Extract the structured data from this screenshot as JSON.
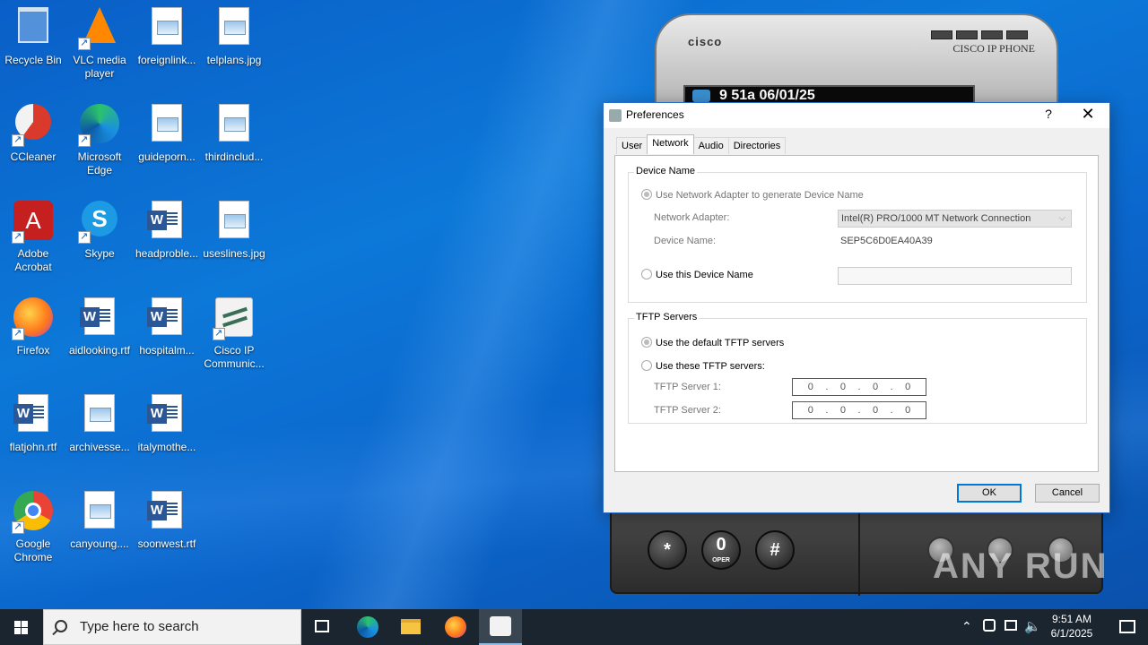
{
  "desktop": {
    "icons": [
      {
        "label": "Recycle Bin",
        "type": "recycle"
      },
      {
        "label": "VLC media player",
        "type": "vlc"
      },
      {
        "label": "foreignlink...",
        "type": "image"
      },
      {
        "label": "telplans.jpg",
        "type": "image"
      },
      {
        "label": "CCleaner",
        "type": "ccleaner"
      },
      {
        "label": "Microsoft Edge",
        "type": "edge"
      },
      {
        "label": "guideporn...",
        "type": "image"
      },
      {
        "label": "thirdinclud...",
        "type": "image"
      },
      {
        "label": "Adobe Acrobat",
        "type": "acrobat"
      },
      {
        "label": "Skype",
        "type": "skype"
      },
      {
        "label": "headproble...",
        "type": "word"
      },
      {
        "label": "useslines.jpg",
        "type": "image"
      },
      {
        "label": "Firefox",
        "type": "firefox"
      },
      {
        "label": "aidlooking.rtf",
        "type": "word"
      },
      {
        "label": "hospitalm...",
        "type": "word"
      },
      {
        "label": "Cisco IP Communic...",
        "type": "cisco"
      },
      {
        "label": "flatjohn.rtf",
        "type": "word"
      },
      {
        "label": "archivesse...",
        "type": "image"
      },
      {
        "label": "italymothe...",
        "type": "word"
      },
      {
        "label": "Google Chrome",
        "type": "chrome"
      },
      {
        "label": "canyoung....",
        "type": "image"
      },
      {
        "label": "soonwest.rtf",
        "type": "word"
      }
    ]
  },
  "phone": {
    "logo": "cisco",
    "brand": "CISCO IP PHONE",
    "screen_text": "9 51a 06/01/25",
    "keys": [
      {
        "main": "*",
        "sub": ""
      },
      {
        "main": "0",
        "sub": "OPER"
      },
      {
        "main": "#",
        "sub": ""
      }
    ]
  },
  "dialog": {
    "title": "Preferences",
    "help": "?",
    "close": "✕",
    "tabs": [
      "User",
      "Network",
      "Audio",
      "Directories"
    ],
    "active_tab": "Network",
    "device_name_group": {
      "title": "Device Name",
      "use_adapter_label": "Use Network Adapter to generate Device Name",
      "network_adapter_label": "Network Adapter:",
      "network_adapter_value": "Intel(R) PRO/1000 MT Network Connection",
      "device_name_label": "Device Name:",
      "device_name_value": "SEP5C6D0EA40A39",
      "use_this_label": "Use this Device Name",
      "use_this_value": ""
    },
    "tftp_group": {
      "title": "TFTP Servers",
      "default_label": "Use the default TFTP servers",
      "these_label": "Use these TFTP servers:",
      "server1_label": "TFTP Server 1:",
      "server2_label": "TFTP Server 2:",
      "server1_octets": [
        "0",
        "0",
        "0",
        "0"
      ],
      "server2_octets": [
        "0",
        "0",
        "0",
        "0"
      ]
    },
    "ok_label": "OK",
    "cancel_label": "Cancel"
  },
  "taskbar": {
    "search_placeholder": "Type here to search",
    "time": "9:51 AM",
    "date": "6/1/2025"
  },
  "watermark": "ANY RUN"
}
